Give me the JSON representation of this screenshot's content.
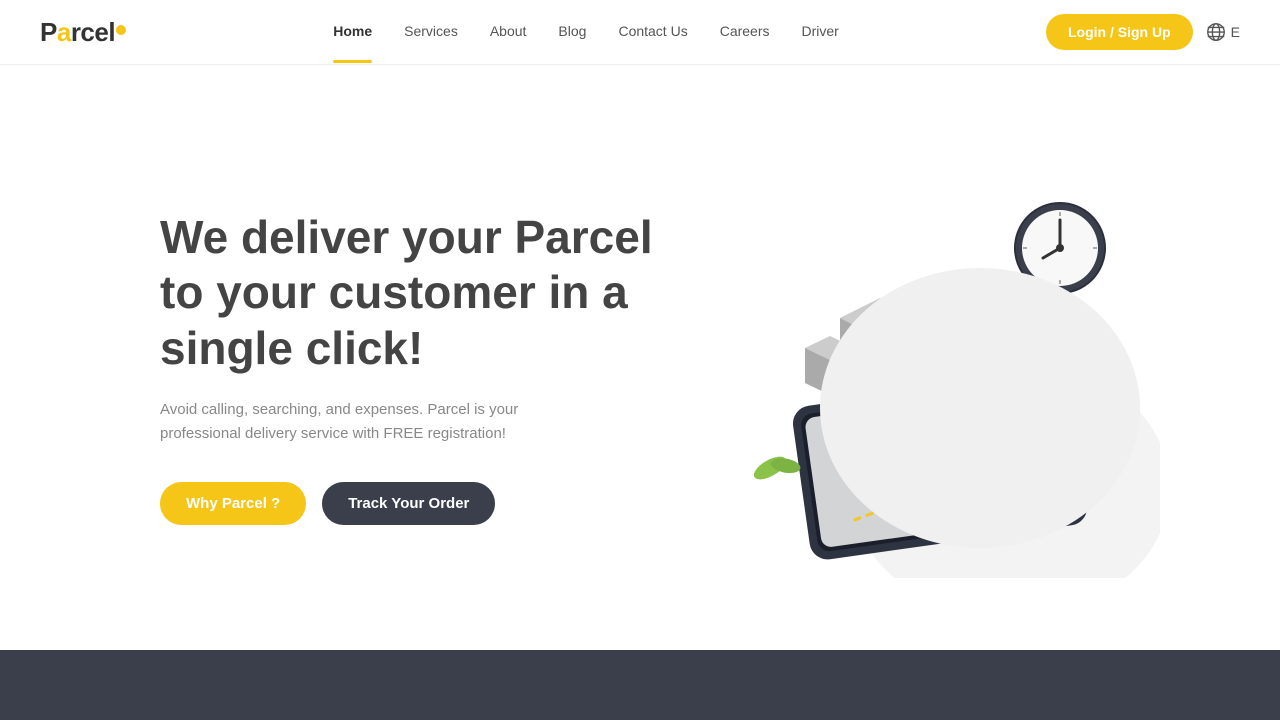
{
  "logo": {
    "text": "Parcel",
    "has_dot": true
  },
  "nav": {
    "links": [
      {
        "label": "Home",
        "active": true
      },
      {
        "label": "Services",
        "active": false
      },
      {
        "label": "About",
        "active": false
      },
      {
        "label": "Blog",
        "active": false
      },
      {
        "label": "Contact Us",
        "active": false
      },
      {
        "label": "Careers",
        "active": false
      },
      {
        "label": "Driver",
        "active": false
      }
    ],
    "login_label": "Login / Sign Up",
    "lang_code": "E"
  },
  "hero": {
    "title": "We deliver your Parcel to your customer in a single click!",
    "subtitle": "Avoid calling, searching, and expenses. Parcel is your professional delivery service with FREE registration!",
    "btn_why": "Why Parcel ?",
    "btn_track": "Track Your Order"
  },
  "colors": {
    "yellow": "#F5C518",
    "dark": "#3a3f4b",
    "text": "#444",
    "muted": "#888"
  }
}
